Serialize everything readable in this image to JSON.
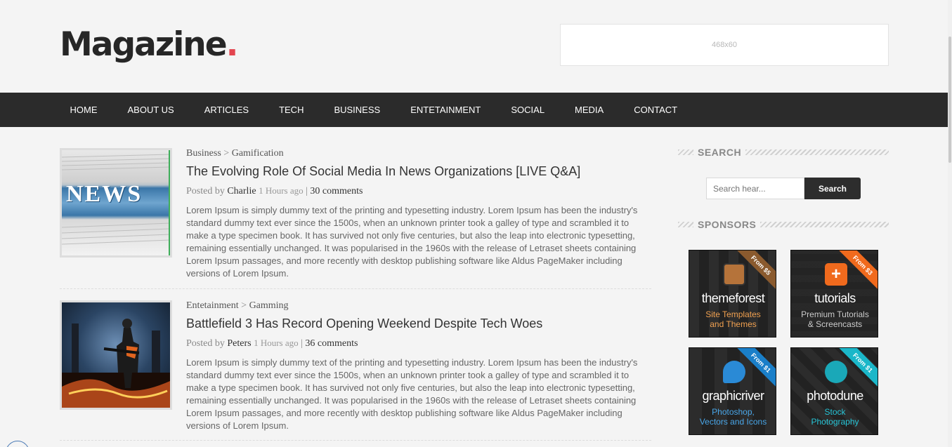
{
  "header": {
    "logo_text": "Magazine",
    "logo_dot": ".",
    "ad_label": "468x60"
  },
  "nav": {
    "items": [
      "HOME",
      "ABOUT US",
      "ARTICLES",
      "TECH",
      "BUSINESS",
      "ENTETAINMENT",
      "SOCIAL",
      "MEDIA",
      "CONTACT"
    ]
  },
  "posts": [
    {
      "category": "Business",
      "separator": ">",
      "subcategory": "Gamification",
      "title": "The Evolving Role Of Social Media In News Organizations [LIVE Q&A]",
      "posted_by_label": "Posted by",
      "author": "Charlie",
      "ago": "1 Hours ago",
      "divider": "|",
      "comments": "30 comments",
      "excerpt": "Lorem Ipsum is simply dummy text of the printing and typesetting industry. Lorem Ipsum has been the industry's standard dummy text ever since the 1500s, when an unknown printer took a galley of type and scrambled it to make a type specimen book. It has survived not only five centuries, but also the leap into electronic typesetting, remaining essentially unchanged. It was popularised in the 1960s with the release of Letraset sheets containing Lorem Ipsum passages, and more recently with desktop publishing software like Aldus PageMaker including versions of Lorem Ipsum.",
      "thumb_text": "NEWS"
    },
    {
      "category": "Entetainment",
      "separator": ">",
      "subcategory": "Gamming",
      "title": "Battlefield 3 Has Record Opening Weekend Despite Tech Woes",
      "posted_by_label": "Posted by",
      "author": "Peters",
      "ago": "1 Hours ago",
      "divider": "|",
      "comments": "36 comments",
      "excerpt": "Lorem Ipsum is simply dummy text of the printing and typesetting industry. Lorem Ipsum has been the industry's standard dummy text ever since the 1500s, when an unknown printer took a galley of type and scrambled it to make a type specimen book. It has survived not only five centuries, but also the leap into electronic typesetting, remaining essentially unchanged. It was popularised in the 1960s with the release of Letraset sheets containing Lorem Ipsum passages, and more recently with desktop publishing software like Aldus PageMaker including versions of Lorem Ipsum."
    }
  ],
  "sidebar": {
    "search_heading": "SEARCH",
    "search_placeholder": "Search hear...",
    "search_button": "Search",
    "sponsors_heading": "SPONSORS",
    "sponsors": [
      {
        "name": "themeforest",
        "tag1": "Site Templates",
        "tag2": "and Themes",
        "ribbon": "From $5",
        "ribbon_color": "#8a5a2e",
        "tag_color": "#f0a050",
        "icon_color": "#b5733a"
      },
      {
        "name": "tutorials",
        "tag1": "Premium Tutorials",
        "tag2": "& Screencasts",
        "ribbon": "From $3",
        "ribbon_color": "#f06a1d",
        "tag_color": "#cccccc",
        "icon_color": "#f06a1d"
      },
      {
        "name": "graphicriver",
        "tag1": "Photoshop,",
        "tag2": "Vectors and Icons",
        "ribbon": "From $1",
        "ribbon_color": "#1a7fc9",
        "tag_color": "#49a6e8",
        "icon_color": "#2a8ad6"
      },
      {
        "name": "photodune",
        "tag1": "Stock",
        "tag2": "Photography",
        "ribbon": "From $1",
        "ribbon_color": "#1bb7c9",
        "tag_color": "#28c6d8",
        "icon_color": "#1aa8b8"
      }
    ]
  },
  "colors": {
    "nav_bg": "#2b2b2b",
    "logo_dot": "#e3454f"
  }
}
